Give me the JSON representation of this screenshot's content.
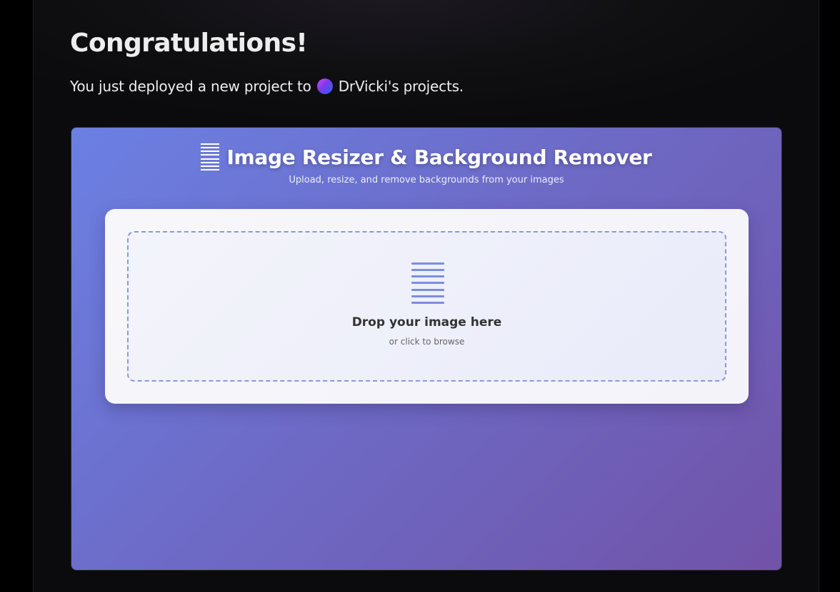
{
  "page": {
    "title": "Congratulations!",
    "subtitle_prefix": "You just deployed a new project to",
    "team_name": "DrVicki's projects."
  },
  "preview": {
    "app_title": "Image Resizer & Background Remover",
    "app_subtitle": "Upload, resize, and remove backgrounds from your images",
    "title_icon": "lines-icon",
    "upload": {
      "icon": "document-lines-icon",
      "title": "Drop your image here",
      "hint": "or click to browse"
    }
  },
  "colors": {
    "page_bg": "#0b0b0d",
    "gradient_start": "#6b80e3",
    "gradient_end": "#7153a8",
    "dropzone_border": "#8b98d8"
  }
}
